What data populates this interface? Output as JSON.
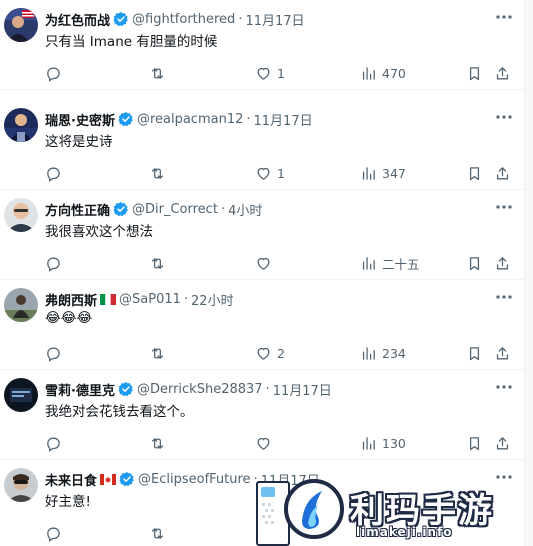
{
  "colors": {
    "verified": "#1d9bf0",
    "muted": "#536471",
    "text": "#0f1419",
    "divider": "#eff3f4"
  },
  "tweets": [
    {
      "name": "为红色而战",
      "handle": "@fightforthered",
      "sep": "·",
      "time": "11月17日",
      "text": "只有当 Imane 有胆量的时候",
      "reply": "",
      "retweet": "",
      "like": "1",
      "views": "470",
      "avatar": "person-with-flag"
    },
    {
      "name": "瑞恩·史密斯",
      "handle": "@realpacman12",
      "sep": "·",
      "time": "11月17日",
      "text": "这将是史诗",
      "reply": "",
      "retweet": "",
      "like": "1",
      "views": "347",
      "avatar": "person-at-podium"
    },
    {
      "name": "方向性正确",
      "handle": "@Dir_Correct",
      "sep": "·",
      "time": "4小时",
      "text": "我很喜欢这个想法",
      "reply": "",
      "retweet": "",
      "like": "",
      "views": "二十五",
      "avatar": "bald-man-glasses"
    },
    {
      "name": "弗朗西斯",
      "name_flag": "italy-flag",
      "handle": "@SaP011",
      "sep": "·",
      "time": "22小时",
      "text": "😂😂😂",
      "reply": "",
      "retweet": "",
      "like": "2",
      "views": "234",
      "avatar": "person-outdoors"
    },
    {
      "name": "雪莉·德里克",
      "handle": "@DerrickShe28837",
      "sep": "·",
      "time": "11月17日",
      "text": "我绝对会花钱去看这个。",
      "reply": "",
      "retweet": "",
      "like": "",
      "views": "130",
      "avatar": "dark-screen"
    },
    {
      "name": "未来日食",
      "name_flag": "canada-flag",
      "handle": "@EclipseofFuture",
      "sep": "·",
      "time": "11月17日",
      "text": "好主意!",
      "reply": "",
      "retweet": "",
      "like": "",
      "views": "",
      "avatar": "man-with-sunglasses"
    }
  ],
  "watermark": {
    "title": "利玛手游",
    "url": "limakeji.info"
  }
}
